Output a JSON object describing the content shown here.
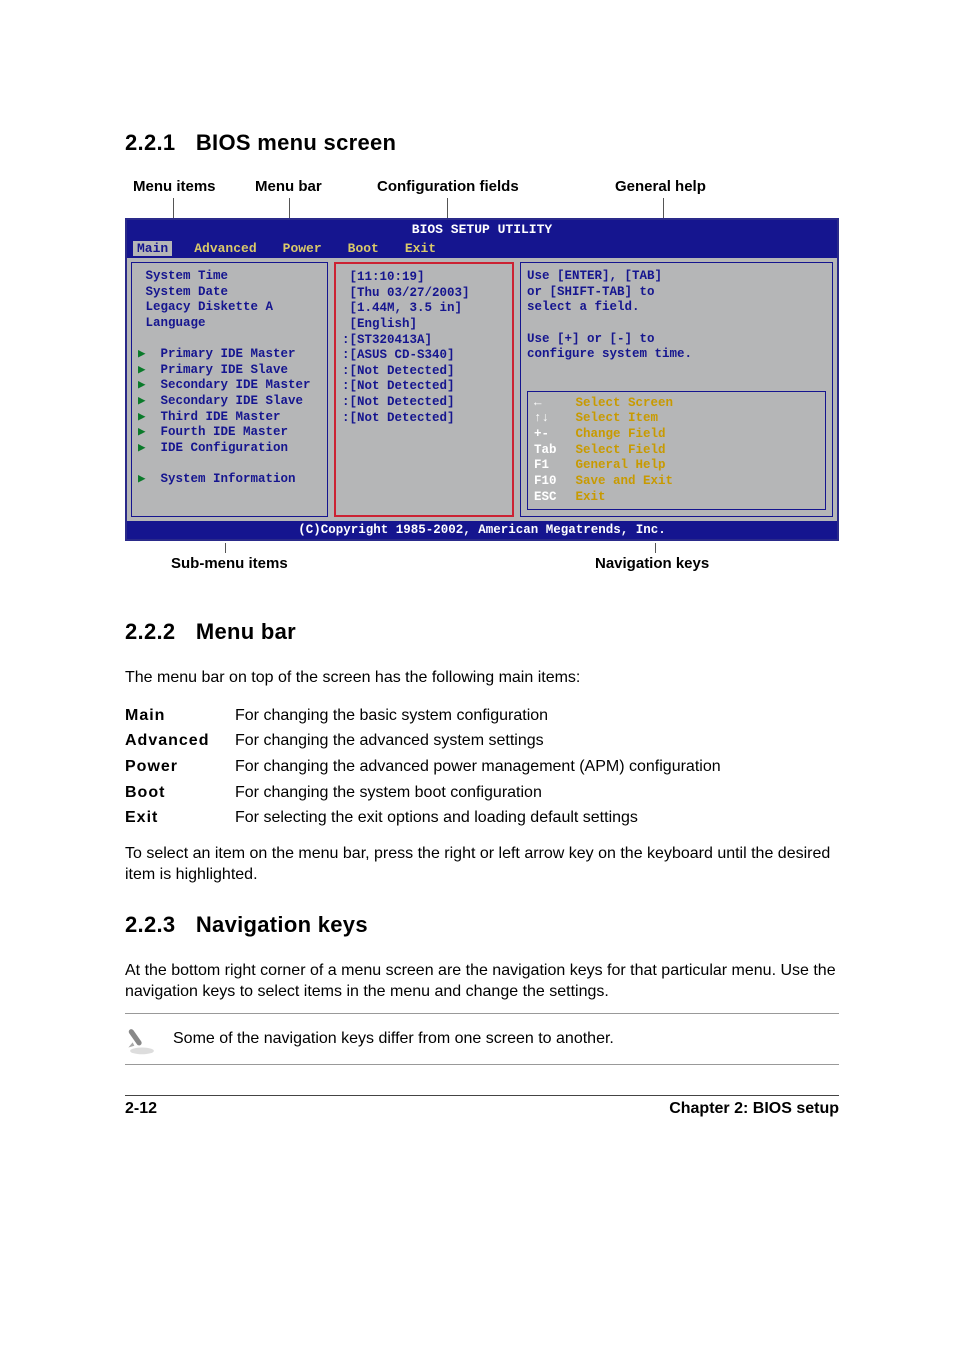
{
  "section1": {
    "num": "2.2.1",
    "title": "BIOS menu screen"
  },
  "callouts_top": {
    "menu_items": "Menu items",
    "menu_bar": "Menu bar",
    "config_fields": "Configuration fields",
    "general_help": "General help"
  },
  "bios": {
    "title": "BIOS SETUP UTILITY",
    "tabs": [
      "Main",
      "Advanced",
      "Power",
      "Boot",
      "Exit"
    ],
    "left_rows": [
      "System Time",
      "System Date",
      "Legacy Diskette A",
      "Language",
      "",
      "  Primary IDE Master",
      "  Primary IDE Slave",
      "  Secondary IDE Master",
      "  Secondary IDE Slave",
      "  Third IDE Master",
      "  Fourth IDE Master",
      "  IDE Configuration",
      "",
      "  System Information"
    ],
    "left_arrow_flags": [
      false,
      false,
      false,
      false,
      false,
      true,
      true,
      true,
      true,
      true,
      true,
      true,
      false,
      true
    ],
    "mid_rows": [
      " [11:10:19]",
      " [Thu 03/27/2003]",
      " [1.44M, 3.5 in]",
      " [English]",
      "",
      ":[ST320413A]",
      ":[ASUS CD-S340]",
      ":[Not Detected]",
      ":[Not Detected]",
      ":[Not Detected]",
      ":[Not Detected]"
    ],
    "help_lines": [
      "Use [ENTER], [TAB]",
      "or [SHIFT-TAB] to",
      "select a field.",
      "",
      "Use [+] or [-] to",
      "configure system time."
    ],
    "nav": [
      {
        "k": "←",
        "t": "Select Screen"
      },
      {
        "k": "↑↓",
        "t": "Select Item"
      },
      {
        "k": "+-",
        "t": "Change Field"
      },
      {
        "k": "Tab",
        "t": "Select Field"
      },
      {
        "k": "F1",
        "t": "General Help"
      },
      {
        "k": "F10",
        "t": "Save and Exit"
      },
      {
        "k": "ESC",
        "t": "Exit"
      }
    ],
    "footer": "(C)Copyright 1985-2002, American Megatrends, Inc."
  },
  "callouts_bottom": {
    "submenu": "Sub-menu items",
    "navkeys": "Navigation keys"
  },
  "section2": {
    "num": "2.2.2",
    "title": "Menu bar",
    "intro": "The menu bar on top of the screen has the following main items:",
    "items": [
      {
        "term": "Main",
        "desc": "For changing the basic system configuration"
      },
      {
        "term": "Advanced",
        "desc": "For changing the advanced system settings"
      },
      {
        "term": "Power",
        "desc": "For changing the advanced power management (APM) configuration"
      },
      {
        "term": "Boot",
        "desc": "For changing the system boot configuration"
      },
      {
        "term": "Exit",
        "desc": "For selecting the exit options and loading default settings"
      }
    ],
    "para": "To select an item on the menu bar, press the right or left arrow key on the keyboard until the desired item is highlighted."
  },
  "section3": {
    "num": "2.2.3",
    "title": "Navigation keys",
    "para": "At the bottom right corner of a menu screen are the navigation keys for that particular menu. Use the navigation keys to select items in the menu and change the settings.",
    "note": "Some of the navigation keys differ from one screen to another."
  },
  "footer": {
    "left": "2-12",
    "right": "Chapter 2: BIOS setup"
  }
}
